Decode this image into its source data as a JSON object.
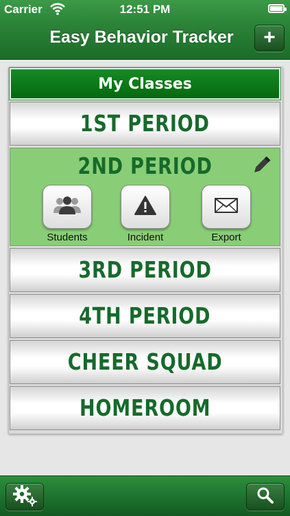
{
  "status_bar": {
    "carrier": "Carrier",
    "time": "12:51 PM"
  },
  "nav": {
    "title": "Easy Behavior Tracker",
    "add_label": "+",
    "add_icon": "plus-icon"
  },
  "section_header": "My Classes",
  "classes": [
    {
      "label": "1ST PERIOD"
    },
    {
      "label": "2ND PERIOD",
      "expanded": true
    },
    {
      "label": "3RD PERIOD"
    },
    {
      "label": "4TH PERIOD"
    },
    {
      "label": "CHEER SQUAD"
    },
    {
      "label": "HOMEROOM"
    }
  ],
  "actions": [
    {
      "label": "Students",
      "icon": "students-icon"
    },
    {
      "label": "Incident",
      "icon": "warning-icon"
    },
    {
      "label": "Export",
      "icon": "envelope-icon"
    }
  ],
  "toolbar": {
    "settings_icon": "gear-icon",
    "search_icon": "search-icon"
  },
  "colors": {
    "brand_green": "#1c6b29",
    "class_text": "#176a2b",
    "expanded_bg": "#89ce77"
  }
}
